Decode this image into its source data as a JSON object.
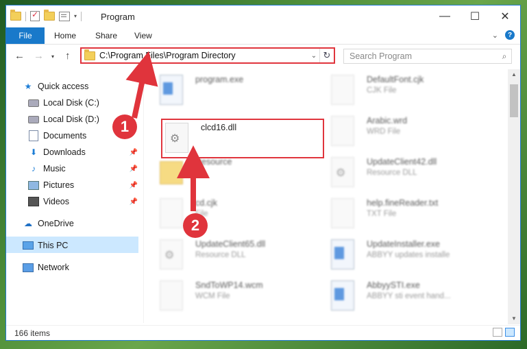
{
  "window": {
    "title": "Program"
  },
  "ribbon": {
    "file": "File",
    "home": "Home",
    "share": "Share",
    "view": "View"
  },
  "address": {
    "path": "C:\\Program Files\\Program Directory"
  },
  "search": {
    "placeholder": "Search Program"
  },
  "sidebar": {
    "items": [
      {
        "label": "Quick access",
        "icon": "star-icon"
      },
      {
        "label": "Local Disk (C:)",
        "icon": "disk-icon"
      },
      {
        "label": "Local Disk (D:)",
        "icon": "disk-icon"
      },
      {
        "label": "Documents",
        "icon": "documents-icon"
      },
      {
        "label": "Downloads",
        "icon": "download-icon"
      },
      {
        "label": "Music",
        "icon": "music-icon"
      },
      {
        "label": "Pictures",
        "icon": "pictures-icon"
      },
      {
        "label": "Videos",
        "icon": "videos-icon"
      },
      {
        "label": "OneDrive",
        "icon": "cloud-icon"
      },
      {
        "label": "This PC",
        "icon": "computer-icon"
      },
      {
        "label": "Network",
        "icon": "network-icon"
      }
    ]
  },
  "files": {
    "left": [
      {
        "name": "program.exe",
        "type": ""
      },
      {
        "name": "clcd16.dll",
        "type": ""
      },
      {
        "name": "Resource",
        "type": ""
      },
      {
        "name": "cd.cjk",
        "type": "File"
      },
      {
        "name": "UpdateClient65.dll",
        "type": "Resource DLL"
      },
      {
        "name": "SndToWP14.wcm",
        "type": "WCM File"
      }
    ],
    "right": [
      {
        "name": "DefaultFont.cjk",
        "type": "CJK File"
      },
      {
        "name": "Arabic.wrd",
        "type": "WRD File"
      },
      {
        "name": "UpdateClient42.dll",
        "type": "Resource DLL"
      },
      {
        "name": "help.fineReader.txt",
        "type": "TXT File"
      },
      {
        "name": "UpdateInstaller.exe",
        "type": "ABBYY updates installe"
      },
      {
        "name": "AbbyySTI.exe",
        "type": "ABBYY sti event hand..."
      }
    ]
  },
  "status": {
    "count": "166 items"
  },
  "annotations": {
    "step1": "1",
    "step2": "2"
  },
  "colors": {
    "accent": "#1979ca",
    "highlight": "#e0343c"
  }
}
